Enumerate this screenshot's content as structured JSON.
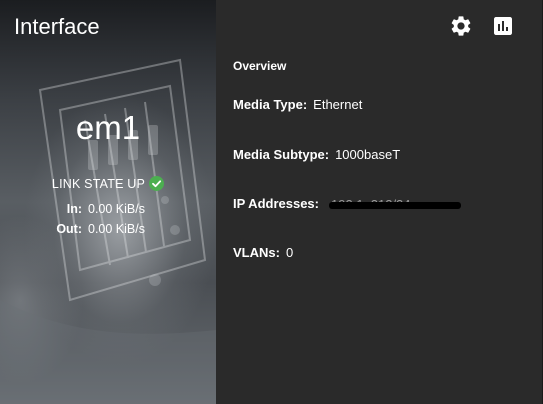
{
  "panel": {
    "title": "Interface",
    "interface_name": "em1",
    "link_state": "LINK STATE UP",
    "traffic": {
      "in_label": "In:",
      "in_value": "0.00 KiB/s",
      "out_label": "Out:",
      "out_value": "0.00 KiB/s"
    }
  },
  "toolbar": {
    "settings_icon": "gear-icon",
    "stats_icon": "bar-chart-icon"
  },
  "overview": {
    "title": "Overview",
    "media_type_label": "Media Type:",
    "media_type_value": "Ethernet",
    "media_subtype_label": "Media Subtype:",
    "media_subtype_value": "1000baseT",
    "ip_label": "IP Addresses:",
    "ip_value_partial": "192.1          .212/24",
    "vlans_label": "VLANs:",
    "vlans_value": "0"
  },
  "colors": {
    "status_ok": "#4caf50",
    "panel_bg": "#2a2a2a",
    "text": "#ffffff"
  }
}
